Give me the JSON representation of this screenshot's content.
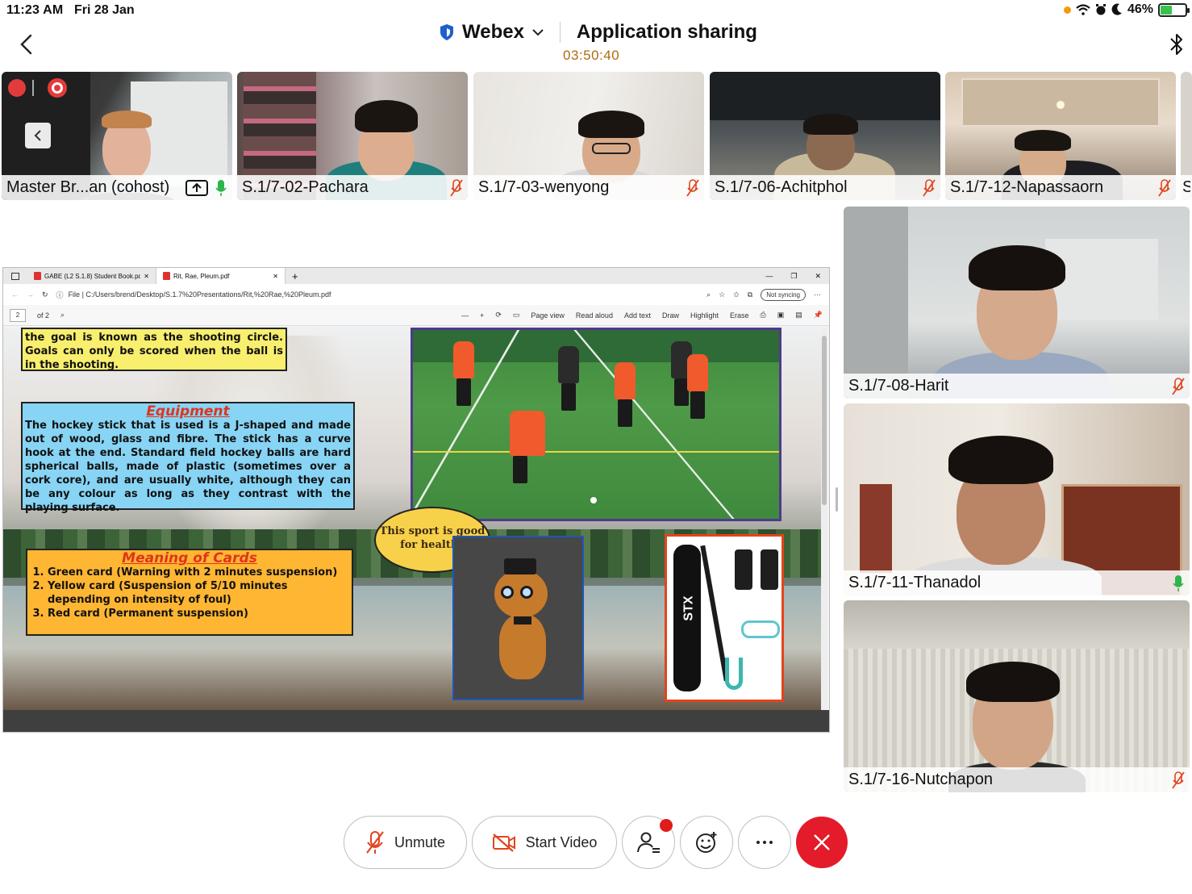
{
  "status_bar": {
    "time": "11:23 AM",
    "date": "Fri 28 Jan",
    "battery": "46%"
  },
  "header": {
    "app_name": "Webex",
    "title": "Application sharing",
    "timer": "03:50:40"
  },
  "thumbnails": [
    {
      "name": "Master Br...an (cohost)",
      "mic": "on"
    },
    {
      "name": "S.1/7-02-Pachara",
      "mic": "muted"
    },
    {
      "name": "S.1/7-03-wenyong",
      "mic": "muted"
    },
    {
      "name": "S.1/7-06-Achitphol",
      "mic": "muted"
    },
    {
      "name": "S.1/7-12-Napassaorn",
      "mic": "muted"
    }
  ],
  "overflow_tile_initial": "S",
  "tiles": [
    {
      "name": "S.1/7-08-Harit",
      "mic": "muted"
    },
    {
      "name": "S.1/7-11-Thanadol",
      "mic": "on"
    },
    {
      "name": "S.1/7-16-Nutchapon",
      "mic": "muted"
    }
  ],
  "shared_screen": {
    "tabs": [
      "GABE (L2 S.1.8) Student Book.pd",
      "Rit, Rae, Pleum.pdf"
    ],
    "address": "File  |  C:/Users/brend/Desktop/S.1.7%20Presentations/Rit,%20Rae,%20Pleum.pdf",
    "sync": "Not syncing",
    "page": "2",
    "page_of": "of 2",
    "toolbar": [
      "Page view",
      "Read aloud",
      "Add text",
      "Draw",
      "Highlight",
      "Erase"
    ],
    "slide": {
      "goal_text": "the goal is known as the shooting circle. Goals can only be scored when the ball is in the shooting.",
      "equipment_title": "Equipment",
      "equipment_text": "The hockey stick that is used is a J-shaped and made out of wood, glass and fibre. The stick has a curve hook at the end. Standard field hockey balls are hard spherical balls, made of plastic (sometimes over a cork core), and are usually white, although they can be any colour as long as they contrast with the playing surface.",
      "bubble_text": "This sport is good for healthy",
      "cards_title": "Meaning of  Cards",
      "cards": [
        "Green card (Warning with 2 minutes suspension)",
        "Yellow card (Suspension of 5/10 minutes depending on intensity of foul)",
        "Red card (Permanent suspension)"
      ],
      "stick_brand": "STX"
    }
  },
  "controls": {
    "unmute": "Unmute",
    "start_video": "Start Video"
  },
  "colors": {
    "end_call": "#e31b2a",
    "timer": "#b06b12",
    "mic_muted": "#e0451f",
    "mic_on": "#2fb34b"
  }
}
